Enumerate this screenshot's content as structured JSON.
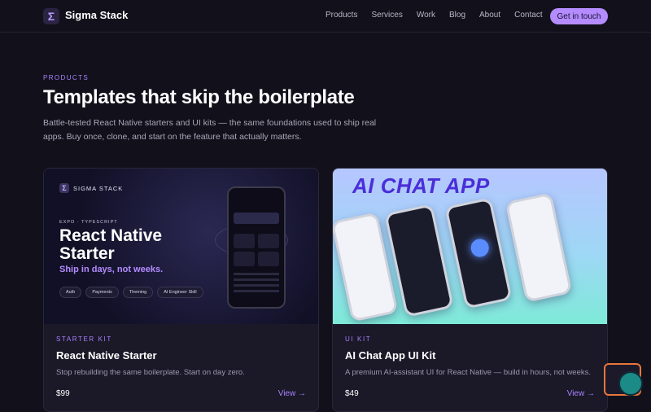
{
  "nav": {
    "brand": "Sigma Stack",
    "logo_glyph": "Σ",
    "items": [
      "Products",
      "Services",
      "Work",
      "Blog",
      "About",
      "Contact"
    ],
    "cta": "Get in touch"
  },
  "section": {
    "eyebrow": "PRODUCTS",
    "title": "Templates that skip the boilerplate",
    "description": "Battle-tested React Native starters and UI kits — the same foundations used to ship real apps. Buy once, clone, and start on the feature that actually matters."
  },
  "cards": [
    {
      "hero": {
        "brand": "SIGMA STACK",
        "tag": "EXPO · TYPESCRIPT",
        "title": "React Native Starter",
        "subtitle": "Ship in days, not weeks.",
        "pills": [
          "Auth",
          "Payments",
          "Theming",
          "AI Engineer Skill"
        ]
      },
      "kicker": "STARTER KIT",
      "title": "React Native Starter",
      "description": "Stop rebuilding the same boilerplate. Start on day zero.",
      "price": "$99",
      "view": "View →"
    },
    {
      "hero": {
        "title": "AI CHAT APP"
      },
      "kicker": "UI KIT",
      "title": "AI Chat App UI Kit",
      "description": "A premium AI-assistant UI for React Native — build in hours, not weeks.",
      "price": "$49",
      "view": "View →"
    }
  ],
  "colors": {
    "background": "#12111b",
    "accent": "#b48cff",
    "card": "#1b1828"
  }
}
